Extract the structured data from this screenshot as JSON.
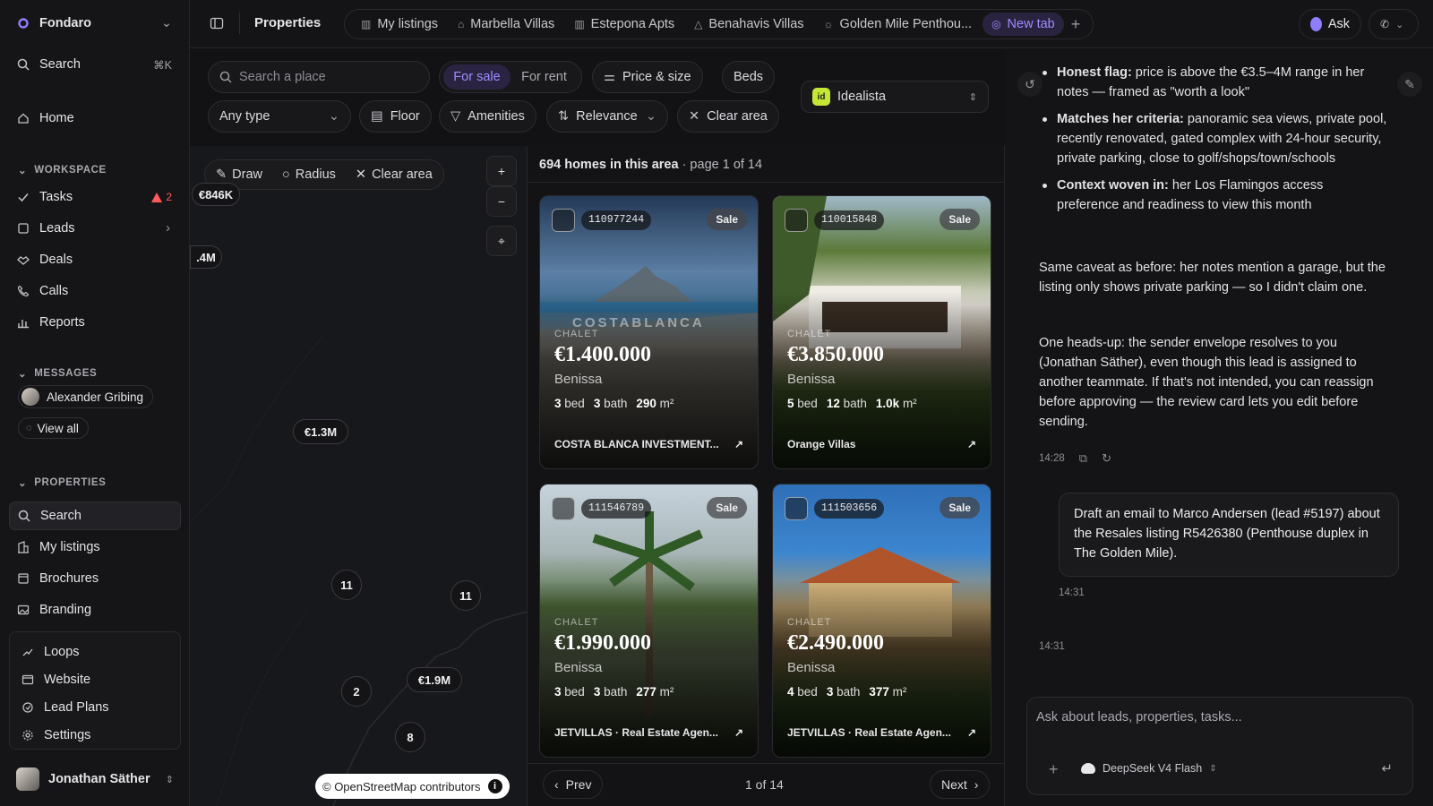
{
  "sidebar": {
    "org": "Fondaro",
    "search_label": "Search",
    "search_shortcut": "⌘K",
    "home": "Home",
    "workspace_header": "WORKSPACE",
    "workspace_items": [
      {
        "label": "Tasks",
        "badge": "2"
      },
      {
        "label": "Leads"
      },
      {
        "label": "Deals"
      },
      {
        "label": "Calls"
      },
      {
        "label": "Reports"
      }
    ],
    "messages_header": "MESSAGES",
    "contact": "Alexander Gribing",
    "view_all": "View all",
    "properties_header": "PROPERTIES",
    "property_items": [
      "Search",
      "My listings",
      "Brochures",
      "Branding"
    ],
    "group_items": [
      "Loops",
      "Website",
      "Lead Plans",
      "Settings"
    ],
    "user": "Jonathan Säther"
  },
  "topbar": {
    "title": "Properties",
    "tabs": [
      "My listings",
      "Marbella Villas",
      "Estepona Apts",
      "Benahavis Villas",
      "Golden Mile Penthou...",
      "New tab"
    ],
    "ask": "Ask"
  },
  "filters": {
    "search_placeholder": "Search a place",
    "for_sale": "For sale",
    "for_rent": "For rent",
    "price_size": "Price & size",
    "beds": "Beds",
    "source": "Idealista",
    "source_badge": "id",
    "type": "Any type",
    "floor": "Floor",
    "amenities": "Amenities",
    "sort": "Relevance",
    "clear_area": "Clear area"
  },
  "map": {
    "draw": "Draw",
    "radius": "Radius",
    "clear_area": "Clear area",
    "markers": [
      "€846K",
      ".4M",
      "€1.3M",
      "11",
      "11",
      "€1.9M",
      "2",
      "8"
    ],
    "attribution": "© OpenStreetMap contributors"
  },
  "results": {
    "count": "694 homes in this area",
    "page_info": "· page 1 of 14",
    "listings": [
      {
        "ref": "110977244",
        "status": "Sale",
        "type": "CHALET",
        "price": "€1.400.000",
        "location": "Benissa",
        "beds": "3",
        "baths": "3",
        "size": "290",
        "agent": "COSTA BLANCA INVESTMENT...",
        "watermark": "COSTABLANCA"
      },
      {
        "ref": "110015848",
        "status": "Sale",
        "type": "CHALET",
        "price": "€3.850.000",
        "location": "Benissa",
        "beds": "5",
        "baths": "12",
        "size": "1.0k",
        "agent": "Orange Villas"
      },
      {
        "ref": "111546789",
        "status": "Sale",
        "type": "CHALET",
        "price": "€1.990.000",
        "location": "Benissa",
        "beds": "3",
        "baths": "3",
        "size": "277",
        "agent": "JETVILLAS · Real Estate Agen..."
      },
      {
        "ref": "111503656",
        "status": "Sale",
        "type": "CHALET",
        "price": "€2.490.000",
        "location": "Benissa",
        "beds": "4",
        "baths": "3",
        "size": "377",
        "agent": "JETVILLAS · Real Estate Agen..."
      }
    ],
    "unit_bed": "bed",
    "unit_bath": "bath",
    "unit_m2": "m²",
    "prev": "Prev",
    "next": "Next",
    "page": "1 of 14"
  },
  "chat": {
    "bullets": [
      {
        "bold": "Honest flag:",
        "text": " price is above the €3.5–4M range in her notes — framed as \"worth a look\""
      },
      {
        "bold": "Matches her criteria:",
        "text": " panoramic sea views, private pool, recently renovated, gated complex with 24-hour security, private parking, close to golf/shops/town/schools"
      },
      {
        "bold": "Context woven in:",
        "text": " her Los Flamingos access preference and readiness to view this month"
      }
    ],
    "para1": "Same caveat as before: her notes mention a garage, but the listing only shows private parking — so I didn't claim one.",
    "para2": "One heads-up: the sender envelope resolves to you (Jonathan Säther), even though this lead is assigned to another teammate. If that's not intended, you can reassign before approving — the review card lets you edit before sending.",
    "time1": "14:28",
    "user_msg": "Draft an email to Marco Andersen (lead #5197) about the Resales listing R5426380 (Penthouse duplex in The Golden Mile).",
    "time2": "14:31",
    "time3": "14:31",
    "input_placeholder": "Ask about leads, properties, tasks...",
    "model": "DeepSeek V4 Flash"
  },
  "colors": {
    "accent": "#9d8cff",
    "alert": "#ff5b5b",
    "background": "#121214"
  }
}
